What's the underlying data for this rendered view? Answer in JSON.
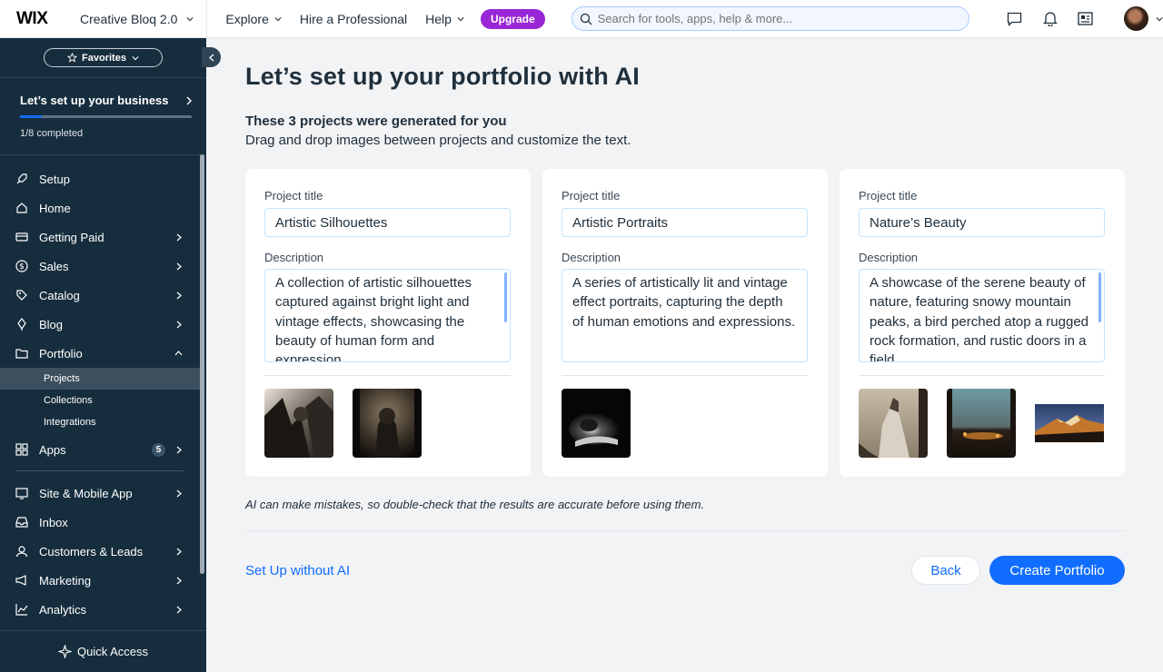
{
  "topbar": {
    "logo": "WIX",
    "site_name": "Creative Bloq 2.0",
    "nav": [
      "Explore",
      "Hire a Professional",
      "Help"
    ],
    "upgrade_label": "Upgrade",
    "search_placeholder": "Search for tools, apps, help & more..."
  },
  "sidebar": {
    "favorites_label": "Favorites",
    "setup_title": "Let’s set up your business",
    "progress_text": "1/8 completed",
    "progress_fraction": 0.125,
    "items": [
      {
        "label": "Setup",
        "icon": "rocket-icon"
      },
      {
        "label": "Home",
        "icon": "home-icon"
      },
      {
        "label": "Getting Paid",
        "icon": "credit-card-icon"
      },
      {
        "label": "Sales",
        "icon": "dollar-icon"
      },
      {
        "label": "Catalog",
        "icon": "tag-icon"
      },
      {
        "label": "Blog",
        "icon": "quill-icon"
      },
      {
        "label": "Portfolio",
        "icon": "portfolio-icon"
      }
    ],
    "portfolio_sub": [
      "Projects",
      "Collections",
      "Integrations"
    ],
    "apps_label": "Apps",
    "apps_badge": "5",
    "items2": [
      {
        "label": "Site & Mobile App",
        "icon": "site-icon"
      },
      {
        "label": "Inbox",
        "icon": "inbox-icon"
      },
      {
        "label": "Customers & Leads",
        "icon": "customers-icon"
      },
      {
        "label": "Marketing",
        "icon": "marketing-icon"
      },
      {
        "label": "Analytics",
        "icon": "analytics-icon"
      }
    ],
    "quick_access": "Quick Access"
  },
  "main": {
    "title": "Let’s set up your portfolio with AI",
    "subtitle": "These 3 projects were generated for you",
    "subtext": "Drag and drop images between projects and customize the text.",
    "project_title_label": "Project title",
    "description_label": "Description",
    "cards": [
      {
        "title": "Artistic Silhouettes",
        "description": "A collection of artistic silhouettes captured against bright light and vintage effects, showcasing the beauty of human form and expression."
      },
      {
        "title": "Artistic Portraits",
        "description": "A series of artistically lit and vintage effect portraits, capturing the depth of human emotions and expressions."
      },
      {
        "title": "Nature’s Beauty",
        "description": "A showcase of the serene beauty of nature, featuring snowy mountain peaks, a bird perched atop a rugged rock formation, and rustic doors in a field."
      }
    ],
    "ai_note": "AI can make mistakes, so double-check that the results are accurate before using them.",
    "setup_without_ai": "Set Up without AI",
    "back_label": "Back",
    "create_label": "Create Portfolio"
  },
  "colors": {
    "accent": "#116dff",
    "upgrade": "#9a27d5",
    "sidebar_bg": "#162d3d"
  }
}
